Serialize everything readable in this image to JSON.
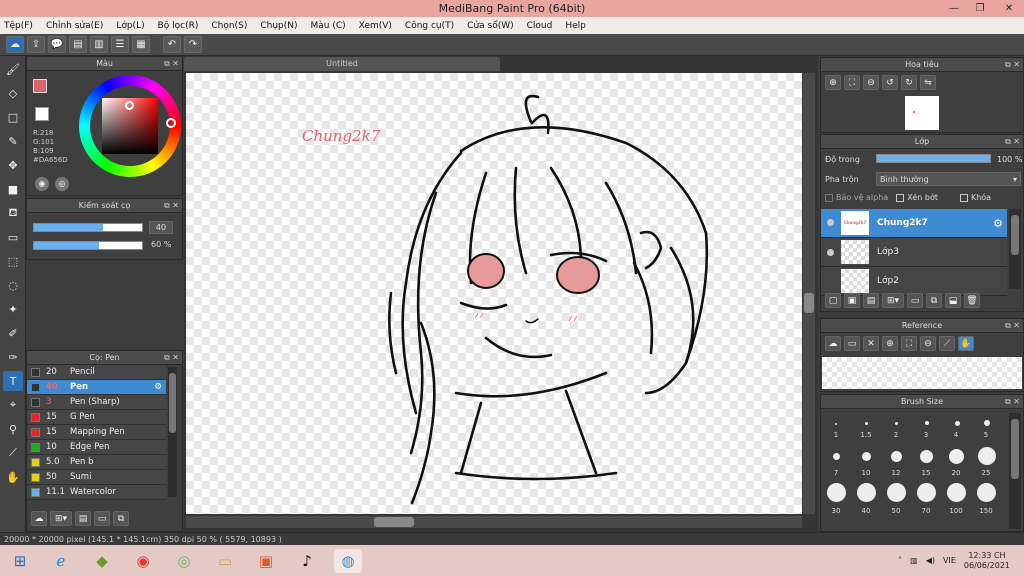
{
  "window": {
    "title": "MediBang Paint Pro (64bit)",
    "minimize": "—",
    "restore": "❐",
    "close": "✕"
  },
  "menu": [
    "Tệp(F)",
    "Chỉnh sửa(E)",
    "Lớp(L)",
    "Bộ lọc(R)",
    "Chọn(S)",
    "Chụp(N)",
    "Màu (C)",
    "Xem(V)",
    "Công cụ(T)",
    "Cửa sổ(W)",
    "Cloud",
    "Help"
  ],
  "toolbar": {
    "undo": "↶",
    "redo": "↷"
  },
  "color_panel": {
    "title": "Màu",
    "foreground": "#DA656D",
    "r": "R:218",
    "g": "G:101",
    "b": "B:109",
    "hex": "#DA656D"
  },
  "brush_control": {
    "title": "Kiểm soát cọ",
    "size": "40",
    "size_fraction": 0.64,
    "opacity": "60 %",
    "opacity_fraction": 0.6
  },
  "brush_list": {
    "title": "Cọ: Pen",
    "items": [
      {
        "size": "20",
        "name": "Pencil",
        "color": "#333333"
      },
      {
        "size": "40",
        "name": "Pen",
        "color": "#333333"
      },
      {
        "size": "3",
        "name": "Pen (Sharp)",
        "color": "#333333"
      },
      {
        "size": "15",
        "name": "G Pen",
        "color": "#e02828"
      },
      {
        "size": "15",
        "name": "Mapping Pen",
        "color": "#e02828"
      },
      {
        "size": "10",
        "name": "Edge Pen",
        "color": "#22aa22"
      },
      {
        "size": "5.0",
        "name": "Pen b",
        "color": "#e0d020"
      },
      {
        "size": "50",
        "name": "Sumi",
        "color": "#e0d020"
      },
      {
        "size": "11.1",
        "name": "Watercolor",
        "color": "#6ab0ea"
      }
    ]
  },
  "document": {
    "tab": "Untitled",
    "watermark_text": "Chung2k7"
  },
  "navigator": {
    "title": "Hoa tiêu"
  },
  "layers": {
    "title": "Lớp",
    "opacity_label": "Độ trong",
    "opacity_value": "100 %",
    "opacity_fraction": 1.0,
    "blend_label": "Pha trộn",
    "blend_value": "Bình thường",
    "protect_alpha": "Bảo vệ alpha",
    "clipping": "Xén bớt",
    "lock": "Khóa",
    "items": [
      {
        "name": "Chung2k7",
        "thumb": "Chung2k7"
      },
      {
        "name": "Lớp3"
      },
      {
        "name": "Lớp2"
      }
    ]
  },
  "reference": {
    "title": "Reference"
  },
  "brush_size": {
    "title": "Brush Size",
    "labels": [
      "1",
      "1.5",
      "2",
      "3",
      "4",
      "5",
      "7",
      "10",
      "12",
      "15",
      "20",
      "25",
      "30",
      "40",
      "50",
      "70",
      "100",
      "150"
    ]
  },
  "status": {
    "text": "20000 * 20000 pixel  (145.1 * 145.1cm)  350 dpi  50 %  ( 5579, 10893 )"
  },
  "taskbar": {
    "lang": "VIE",
    "time": "12:33 CH",
    "date": "06/06/2021"
  }
}
